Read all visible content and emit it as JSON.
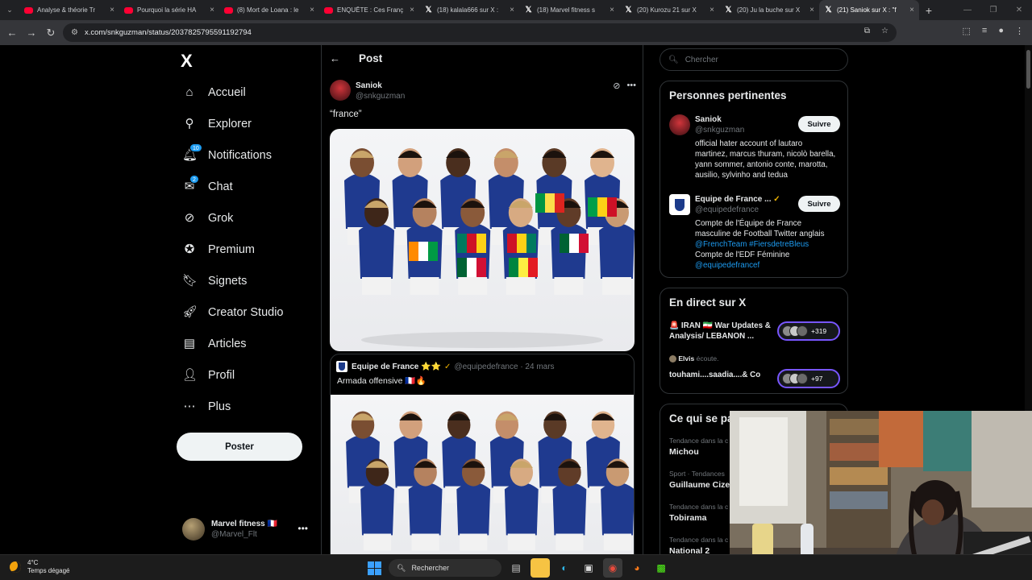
{
  "browser": {
    "tabs": [
      {
        "title": "Analyse & théorie Tr",
        "kind": "youtube"
      },
      {
        "title": "Pourquoi la série HA",
        "kind": "youtube"
      },
      {
        "title": "(8) Mort de Loana : le",
        "kind": "youtube"
      },
      {
        "title": "ENQUÊTE : Ces Franç",
        "kind": "youtube"
      },
      {
        "title": "(18) kalala666 sur X :",
        "kind": "x"
      },
      {
        "title": "(18) Marvel fitness s",
        "kind": "x"
      },
      {
        "title": "(20) Kurozu 21 sur X",
        "kind": "x"
      },
      {
        "title": "(20) Ju la buche sur X",
        "kind": "x"
      },
      {
        "title": "(21) Saniok sur X : \"f",
        "kind": "x",
        "active": true
      }
    ],
    "url": "x.com/snkguzman/status/2037825795591192794"
  },
  "nav": {
    "logo": "X",
    "items": [
      {
        "label": "Accueil",
        "icon": "home-icon"
      },
      {
        "label": "Explorer",
        "icon": "search-icon"
      },
      {
        "label": "Notifications",
        "icon": "bell-icon",
        "badge": "10"
      },
      {
        "label": "Chat",
        "icon": "mail-icon",
        "badge": "2"
      },
      {
        "label": "Grok",
        "icon": "grok-icon"
      },
      {
        "label": "Premium",
        "icon": "premium-icon"
      },
      {
        "label": "Signets",
        "icon": "bookmark-icon"
      },
      {
        "label": "Creator Studio",
        "icon": "rocket-icon"
      },
      {
        "label": "Articles",
        "icon": "article-icon"
      },
      {
        "label": "Profil",
        "icon": "user-icon"
      },
      {
        "label": "Plus",
        "icon": "more-icon"
      }
    ],
    "post_label": "Poster",
    "account": {
      "name": "Marvel fitness 🇫🇷",
      "handle": "@Marvel_Flt"
    }
  },
  "main": {
    "header": "Post",
    "tweet": {
      "name": "Saniok",
      "handle": "@snkguzman",
      "text": "“france”"
    },
    "quote": {
      "name": "Equipe de France ⭐⭐",
      "handle": "@equipedefrance · 24 mars",
      "text": "Armada offensive 🇫🇷🔥"
    }
  },
  "side": {
    "search_placeholder": "Chercher",
    "relevant": {
      "title": "Personnes pertinentes",
      "people": [
        {
          "name": "Saniok",
          "handle": "@snkguzman",
          "follow": "Suivre",
          "bio": "official hater account of lautaro martinez, marcus thuram, nicolò barella, yann sommer, antonio conte, marotta, ausilio, sylvinho and tedua"
        },
        {
          "name": "Equipe de France ...",
          "handle": "@equipedefrance",
          "follow": "Suivre",
          "bio_1": "Compte de l'Équipe de France masculine de Football Twitter anglais",
          "bio_links": "@FrenchTeam #FiersdetreBleus",
          "bio_2": "Compte de l'EDF Féminine",
          "bio_link_2": "@equipedefrancef"
        }
      ]
    },
    "live": {
      "title": "En direct sur X",
      "items": [
        {
          "text": "🚨 IRAN 🇮🇷 War Updates & Analysis/ LEBANON ...",
          "count": "+319"
        },
        {
          "listener": "Elvis",
          "listener_suffix": "écoute.",
          "text": "touhami....saadia....& Co",
          "count": "+97"
        }
      ]
    },
    "trends": {
      "title": "Ce qui se pa",
      "items": [
        {
          "context": "Tendance dans la c",
          "name": "Michou"
        },
        {
          "context": "Sport · Tendances",
          "name": "Guillaume Cizer"
        },
        {
          "context": "Tendance dans la c",
          "name": "Tobirama"
        },
        {
          "context": "Tendance dans la c",
          "name": "National 2"
        }
      ]
    }
  },
  "taskbar": {
    "temperature": "4°C",
    "weather": "Temps dégagé",
    "search": "Rechercher"
  },
  "colors": {
    "accent": "#1d9bf0",
    "live_border": "#7856ff",
    "background": "#000000"
  }
}
